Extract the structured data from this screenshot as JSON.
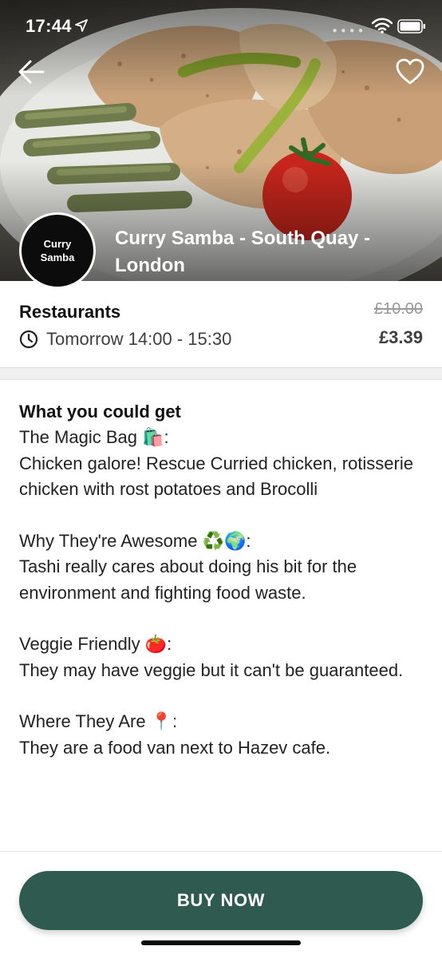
{
  "status_bar": {
    "time": "17:44"
  },
  "store": {
    "logo_line1": "Curry",
    "logo_line2": "Samba",
    "name": "Curry Samba - South Quay - London"
  },
  "info": {
    "category": "Restaurants",
    "pickup": "Tomorrow 14:00 - 15:30",
    "original_price": "£10.00",
    "price": "£3.39"
  },
  "description": {
    "heading": "What you could get",
    "sections": [
      {
        "label": "The Magic Bag 🛍️:",
        "text": "Chicken galore! Rescue Curried chicken, rotisserie chicken with rost potatoes and Brocolli"
      },
      {
        "label": "Why They're Awesome ♻️🌍:",
        "text": "Tashi really cares about doing his bit for the environment and fighting food waste."
      },
      {
        "label": "Veggie Friendly 🍅:",
        "text": "They may have veggie but it can't be guaranteed."
      },
      {
        "label": "Where They Are 📍:",
        "text": "They are a food van next to Hazev cafe."
      }
    ]
  },
  "actions": {
    "buy_label": "BUY NOW"
  },
  "icons": {
    "back": "arrow-left-icon",
    "favorite": "heart-icon",
    "clock": "clock-icon",
    "location": "location-arrow-icon",
    "wifi": "wifi-icon",
    "battery": "battery-icon"
  },
  "colors": {
    "accent": "#2e5a4f"
  }
}
